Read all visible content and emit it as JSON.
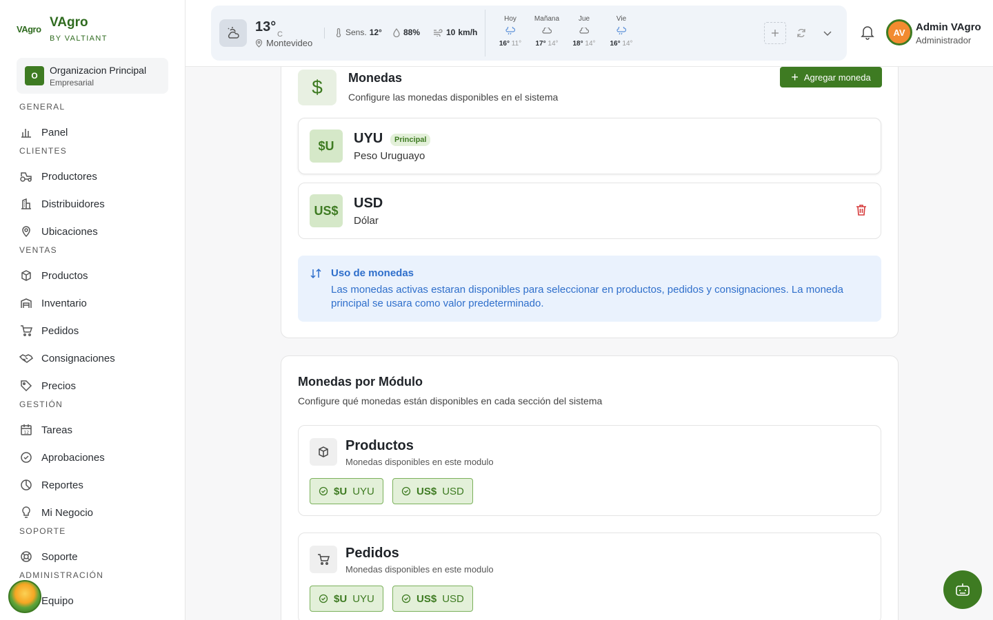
{
  "brand": {
    "logo": "VAgro",
    "name": "VAgro",
    "sub": "BY VALTIANT"
  },
  "org": {
    "initial": "O",
    "name": "Organizacion Principal",
    "type": "Empresarial"
  },
  "nav": {
    "general": "GENERAL",
    "panel": "Panel",
    "clientes": "CLIENTES",
    "productores": "Productores",
    "distribuidores": "Distribuidores",
    "ubicaciones": "Ubicaciones",
    "ventas": "VENTAS",
    "productos": "Productos",
    "inventario": "Inventario",
    "pedidos": "Pedidos",
    "consignaciones": "Consignaciones",
    "precios": "Precios",
    "gestion": "GESTIÓN",
    "tareas": "Tareas",
    "aprobaciones": "Aprobaciones",
    "reportes": "Reportes",
    "negocio": "Mi Negocio",
    "soporte_section": "SOPORTE",
    "soporte": "Soporte",
    "admin": "ADMINISTRACIÓN",
    "equipo": "Equipo"
  },
  "weather": {
    "temp": "13°",
    "unit": "C",
    "location": "Montevideo",
    "feels_label": "Sens.",
    "feels": "12°",
    "humidity": "88%",
    "wind": "10",
    "wind_unit": "km/h",
    "forecast": [
      {
        "day": "Hoy",
        "hi": "16°",
        "lo": "11°"
      },
      {
        "day": "Mañana",
        "hi": "17°",
        "lo": "14°"
      },
      {
        "day": "Jue",
        "hi": "18°",
        "lo": "14°"
      },
      {
        "day": "Vie",
        "hi": "16°",
        "lo": "14°"
      }
    ]
  },
  "user": {
    "initials": "AV",
    "name": "Admin VAgro",
    "role": "Administrador"
  },
  "currencies": {
    "title": "Monedas",
    "description": "Configure las monedas disponibles en el sistema",
    "add_label": "Agregar moneda",
    "items": [
      {
        "symbol": "$U",
        "code": "UYU",
        "badge": "Principal",
        "name": "Peso Uruguayo"
      },
      {
        "symbol": "US$",
        "code": "USD",
        "name": "Dólar"
      }
    ],
    "info_title": "Uso de monedas",
    "info_text": "Las monedas activas estaran disponibles para seleccionar en productos, pedidos y consignaciones. La moneda principal se usara como valor predeterminado."
  },
  "modules": {
    "title": "Monedas por Módulo",
    "description": "Configure qué monedas están disponibles en cada sección del sistema",
    "items": [
      {
        "name": "Productos",
        "sub": "Monedas disponibles en este modulo",
        "chips": [
          {
            "symbol": "$U",
            "code": "UYU"
          },
          {
            "symbol": "US$",
            "code": "USD"
          }
        ]
      },
      {
        "name": "Pedidos",
        "sub": "Monedas disponibles en este modulo",
        "chips": [
          {
            "symbol": "$U",
            "code": "UYU"
          },
          {
            "symbol": "US$",
            "code": "USD"
          }
        ]
      }
    ]
  },
  "colors": {
    "brand": "#3e7b22",
    "info": "#2f6fcb",
    "danger": "#d63b3b"
  }
}
